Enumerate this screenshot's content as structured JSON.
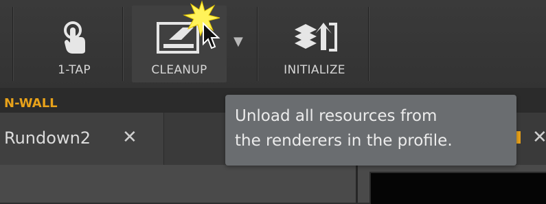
{
  "toolbar": {
    "buttons": [
      {
        "label": "1-TAP",
        "icon": "tap-hand-icon"
      },
      {
        "label": "CLEANUP",
        "icon": "cleanup-eraser-icon"
      },
      {
        "label": "INITIALIZE",
        "icon": "initialize-stack-icon"
      }
    ],
    "dropdown_icon": "caret-down-icon"
  },
  "section": {
    "label": "N-WALL"
  },
  "tabs": [
    {
      "title": "Rundown2",
      "close": "✕"
    }
  ],
  "right_tab_close": "✕",
  "tooltip": {
    "line1": "Unload all resources from",
    "line2": "the renderers in the profile."
  },
  "colors": {
    "accent": "#e8a21a",
    "toolbar_bg": "#363636",
    "tooltip_bg": "#6a6d70"
  }
}
